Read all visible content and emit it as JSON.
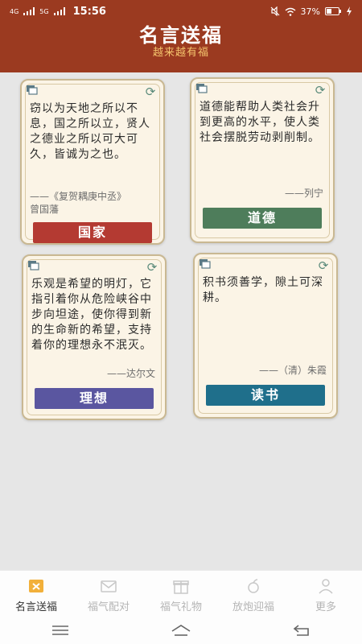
{
  "status_bar": {
    "signal_1": "4G",
    "signal_2": "5G",
    "time": "15:56",
    "battery": "37%"
  },
  "header": {
    "title": "名言送福",
    "subtitle": "越来越有福"
  },
  "cards": [
    {
      "quote": "窃以为天地之所以不息，国之所以立，贤人之德业之所以可大可久，皆诚为之也。",
      "author_line1": "——《复贺耦庚中丞》",
      "author_line2": "曾国藩",
      "tag": "国家",
      "tag_color": "#b43a32"
    },
    {
      "quote": "道德能帮助人类社会升到更高的水平，使人类社会摆脱劳动剥削制。",
      "author_line1": "——列宁",
      "tag": "道德",
      "tag_color": "#4e7d5b"
    },
    {
      "quote": "乐观是希望的明灯，它指引着你从危险峡谷中步向坦途，使你得到新的生命新的希望，支持着你的理想永不泯灭。",
      "author_line1": "——达尔文",
      "tag": "理想",
      "tag_color": "#5a56a0"
    },
    {
      "quote": "积书须善学，隙土可深耕。",
      "author_line1": "——（清）朱霞",
      "tag": "读书",
      "tag_color": "#1f6f8b"
    }
  ],
  "tabs": [
    {
      "label": "名言送福",
      "icon": "quote-gift-icon",
      "active": true
    },
    {
      "label": "福气配对",
      "icon": "envelope-icon",
      "active": false
    },
    {
      "label": "福气礼物",
      "icon": "gift-icon",
      "active": false
    },
    {
      "label": "放炮迎福",
      "icon": "firecracker-icon",
      "active": false
    },
    {
      "label": "更多",
      "icon": "user-icon",
      "active": false
    }
  ]
}
